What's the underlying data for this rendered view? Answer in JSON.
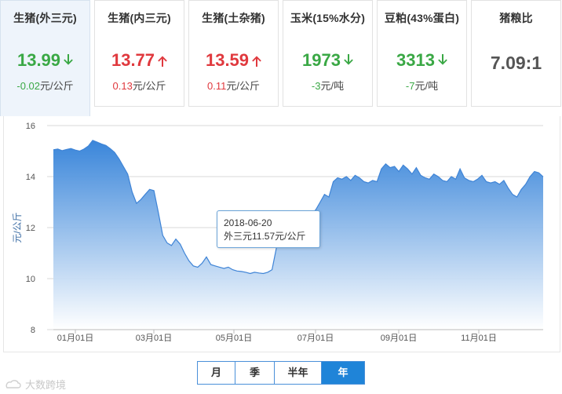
{
  "cards": [
    {
      "title": "生猪(外三元)",
      "value": "13.99",
      "direction": "down",
      "change": "-0.02元/公斤",
      "active": true
    },
    {
      "title": "生猪(内三元)",
      "value": "13.77",
      "direction": "up",
      "change": "0.13元/公斤",
      "active": false
    },
    {
      "title": "生猪(土杂猪)",
      "value": "13.59",
      "direction": "up",
      "change": "0.11元/公斤",
      "active": false
    },
    {
      "title": "玉米(15%水分)",
      "value": "1973",
      "direction": "down",
      "change": "-3元/吨",
      "active": false
    },
    {
      "title": "豆粕(43%蛋白)",
      "value": "3313",
      "direction": "down",
      "change": "-7元/吨",
      "active": false
    },
    {
      "title": "猪粮比",
      "value": "7.09:1",
      "direction": "none",
      "change": "",
      "active": false
    }
  ],
  "colors": {
    "up": "#e0393e",
    "down": "#3aa845",
    "series": "#3f84d6"
  },
  "tooltip": {
    "date": "2018-06-20",
    "text": "外三元11.57元/公斤"
  },
  "range_buttons": [
    {
      "label": "月",
      "selected": false
    },
    {
      "label": "季",
      "selected": false
    },
    {
      "label": "半年",
      "selected": false
    },
    {
      "label": "年",
      "selected": true
    }
  ],
  "watermark": "大数跨境",
  "chart_data": {
    "type": "area",
    "ylabel": "元/公斤",
    "ylim": [
      8,
      16
    ],
    "yticks": [
      "16",
      "14",
      "12",
      "10",
      "8"
    ],
    "xticks": [
      "01月01日",
      "03月01日",
      "05月01日",
      "07月01日",
      "09月01日",
      "11月01日"
    ],
    "grid": true,
    "series": [
      {
        "values": [
          15.05,
          15.08,
          15.02,
          15.06,
          15.1,
          15.04,
          15.0,
          15.08,
          15.2,
          15.42,
          15.35,
          15.28,
          15.22,
          15.1,
          14.95,
          14.7,
          14.4,
          14.1,
          13.4,
          12.95,
          13.1,
          13.3,
          13.5,
          13.45,
          12.6,
          11.7,
          11.4,
          11.3,
          11.55,
          11.35,
          11.0,
          10.7,
          10.5,
          10.45,
          10.6,
          10.85,
          10.55,
          10.5,
          10.45,
          10.4,
          10.45,
          10.35,
          10.3,
          10.28,
          10.25,
          10.2,
          10.25,
          10.22,
          10.2,
          10.25,
          10.35,
          11.2,
          11.57,
          11.8,
          12.0,
          12.2,
          12.05,
          12.3,
          12.65,
          12.55,
          12.7,
          13.0,
          13.3,
          13.2,
          13.8,
          13.95,
          13.9,
          14.0,
          13.85,
          14.05,
          13.95,
          13.8,
          13.75,
          13.85,
          13.8,
          14.3,
          14.5,
          14.35,
          14.4,
          14.2,
          14.45,
          14.3,
          14.1,
          14.35,
          14.05,
          13.95,
          13.9,
          14.1,
          14.0,
          13.85,
          13.8,
          14.0,
          13.9,
          14.3,
          13.95,
          13.85,
          13.8,
          13.9,
          14.05,
          13.8,
          13.75,
          13.8,
          13.7,
          13.85,
          13.55,
          13.3,
          13.2,
          13.5,
          13.7,
          14.0,
          14.2,
          14.15,
          13.99
        ]
      }
    ]
  }
}
